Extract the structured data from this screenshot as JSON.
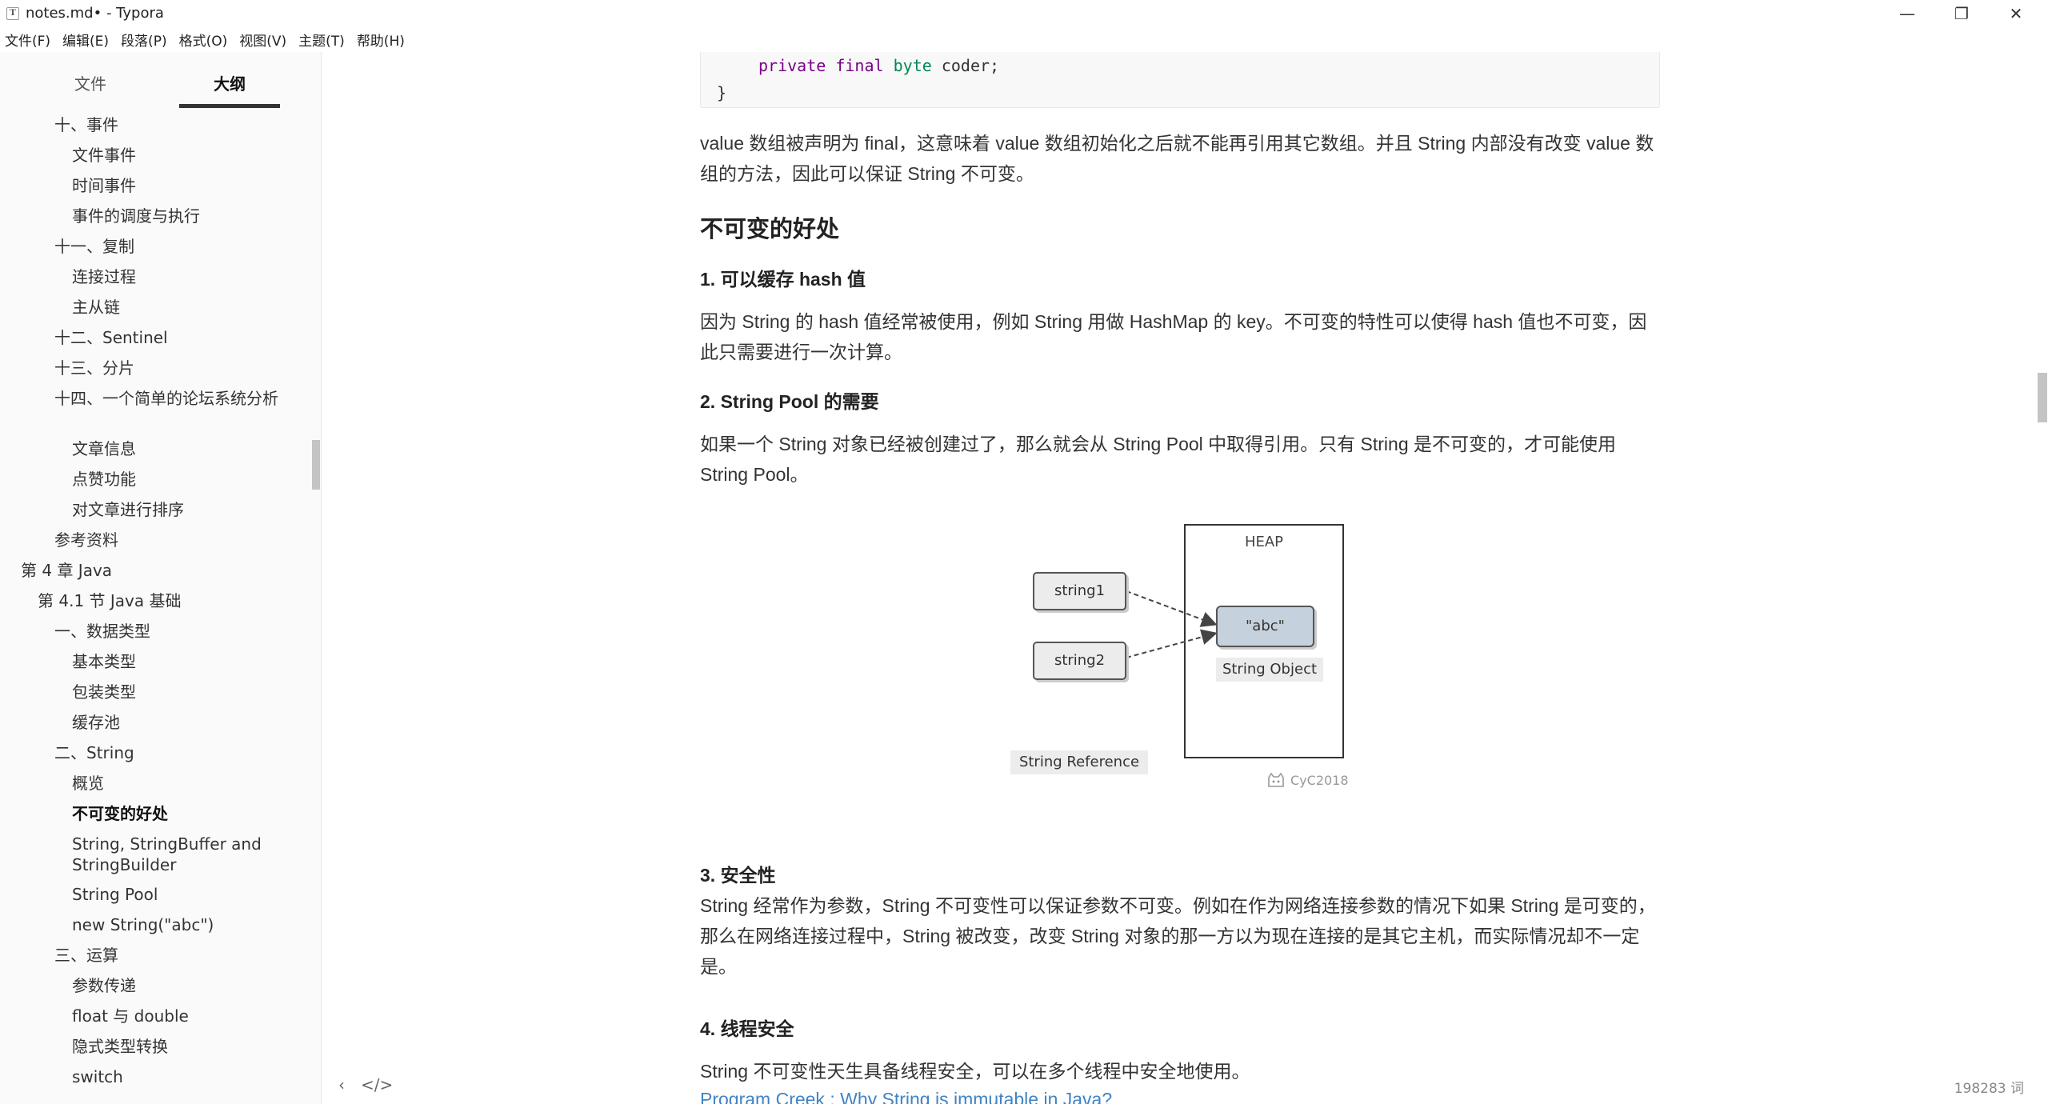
{
  "window": {
    "title": "notes.md• - Typora",
    "icon_glyph": "T",
    "minimize": "—",
    "maximize": "❐",
    "close": "✕"
  },
  "menu": [
    "文件(F)",
    "编辑(E)",
    "段落(P)",
    "格式(O)",
    "视图(V)",
    "主题(T)",
    "帮助(H)"
  ],
  "sidebar": {
    "tab_files": "文件",
    "tab_outline": "大纲",
    "active_tab": "大纲",
    "outline": [
      "十、事件",
      "文件事件",
      "时间事件",
      "事件的调度与执行",
      "十一、复制",
      "连接过程",
      "主从链",
      "十二、Sentinel",
      "十三、分片",
      "十四、一个简单的论坛系统分析",
      "文章信息",
      "点赞功能",
      "对文章进行排序",
      "参考资料",
      "第 4 章 Java",
      "第 4.1 节 Java 基础",
      "一、数据类型",
      "基本类型",
      "包装类型",
      "缓存池",
      "二、String",
      "概览",
      "不可变的好处",
      "String, StringBuffer and StringBuilder",
      "String Pool",
      "new String(\"abc\")",
      "三、运算",
      "参数传递",
      "float 与 double",
      "隐式类型转换",
      "switch"
    ],
    "active_item": "不可变的好处"
  },
  "doc": {
    "code": {
      "kw1": "private",
      "kw2": "final",
      "type": "byte",
      "rest": " coder;",
      "brace": "}"
    },
    "p_final": "value 数组被声明为 final，这意味着 value 数组初始化之后就不能再引用其它数组。并且 String 内部没有改变 value 数组的方法，因此可以保证 String 不可变。",
    "h_benefits": "不可变的好处",
    "h1": "1. 可以缓存 hash 值",
    "p1": "因为 String 的 hash 值经常被使用，例如 String 用做 HashMap 的 key。不可变的特性可以使得 hash 值也不可变，因此只需要进行一次计算。",
    "h2": "2. String Pool 的需要",
    "p2": "如果一个 String 对象已经被创建过了，那么就会从 String Pool 中取得引用。只有 String 是不可变的，才可能使用 String Pool。",
    "diagram": {
      "heap": "HEAP",
      "string1": "string1",
      "string2": "string2",
      "abc": "\"abc\"",
      "string_object": "String Object",
      "string_reference": "String Reference",
      "watermark": "CyC2018"
    },
    "h3": "3. 安全性",
    "p3": "String 经常作为参数，String 不可变性可以保证参数不可变。例如在作为网络连接参数的情况下如果 String 是可变的，那么在网络连接过程中，String 被改变，改变 String 对象的那一方以为现在连接的是其它主机，而实际情况却不一定是。",
    "h4": "4. 线程安全",
    "p4": "String 不可变性天生具备线程安全，可以在多个线程中安全地使用。",
    "link": "Program Creek : Why String is immutable in Java?"
  },
  "status": {
    "toggle_sidebar": "‹",
    "source_mode": "</>",
    "word_count": "198283 词"
  },
  "colors": {
    "keyword": "#770088",
    "type": "#008855",
    "link": "#4183c4",
    "abc_fill": "#c6d1de"
  }
}
